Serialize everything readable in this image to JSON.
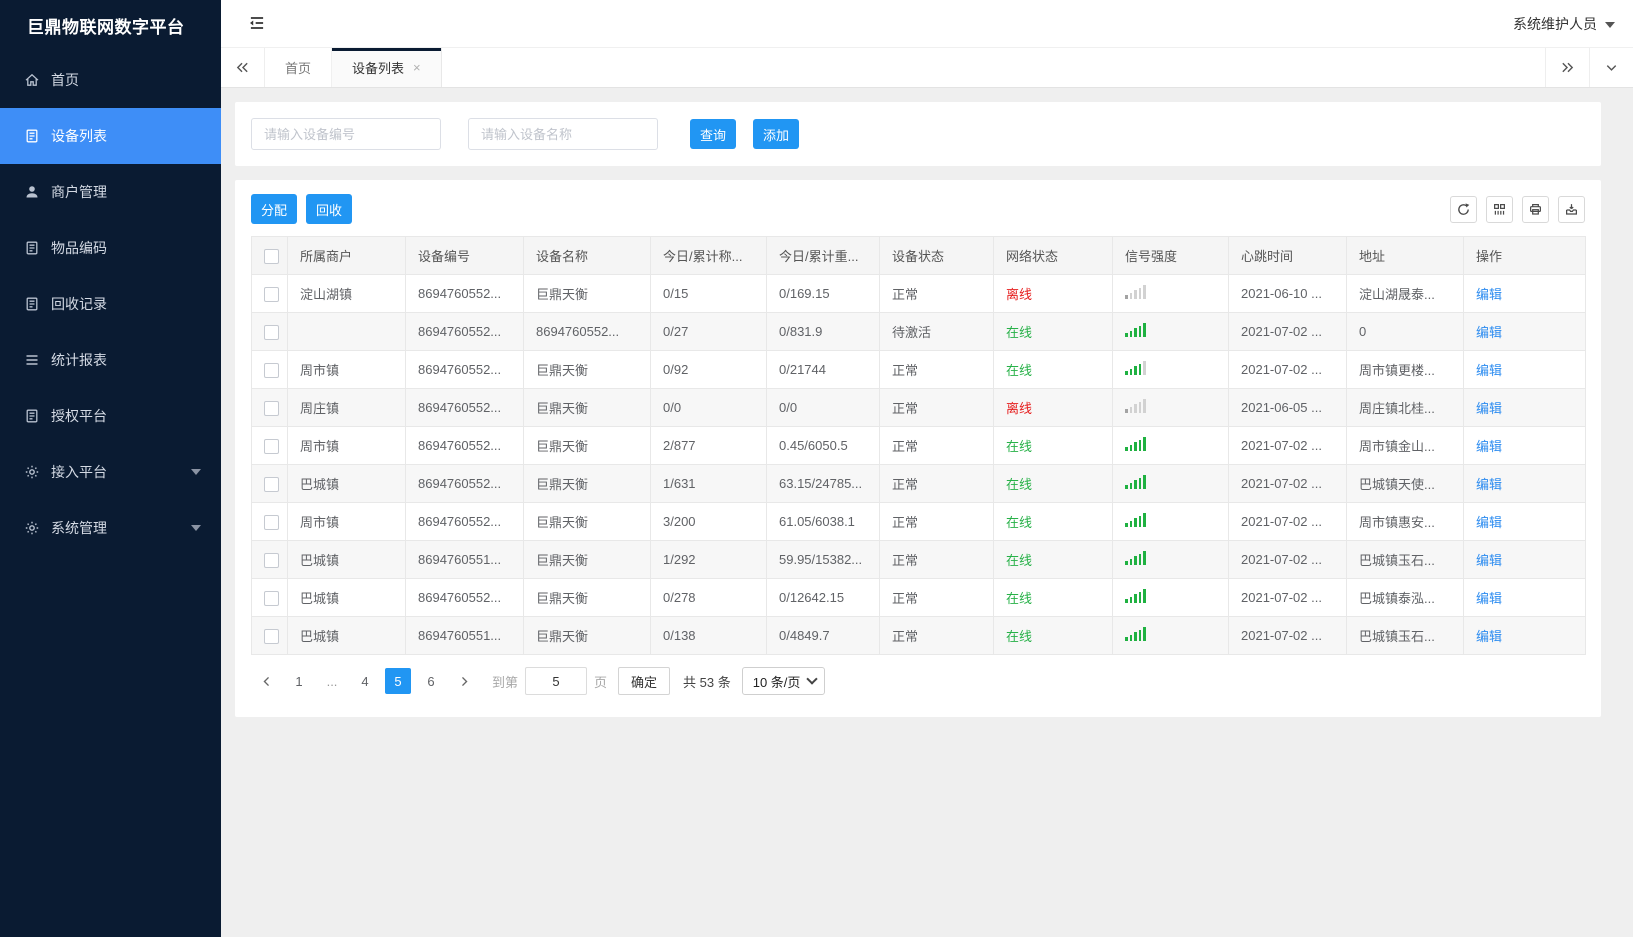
{
  "app": {
    "title": "巨鼎物联网数字平台",
    "user_menu": "系统维护人员"
  },
  "sidebar": {
    "items": [
      {
        "label": "首页",
        "icon": "home",
        "active": false,
        "expandable": false
      },
      {
        "label": "设备列表",
        "icon": "doc",
        "active": true,
        "expandable": false
      },
      {
        "label": "商户管理",
        "icon": "user",
        "active": false,
        "expandable": false
      },
      {
        "label": "物品编码",
        "icon": "doc",
        "active": false,
        "expandable": false
      },
      {
        "label": "回收记录",
        "icon": "doc",
        "active": false,
        "expandable": false
      },
      {
        "label": "统计报表",
        "icon": "menu",
        "active": false,
        "expandable": false
      },
      {
        "label": "授权平台",
        "icon": "doc",
        "active": false,
        "expandable": false
      },
      {
        "label": "接入平台",
        "icon": "gear",
        "active": false,
        "expandable": true
      },
      {
        "label": "系统管理",
        "icon": "gear",
        "active": false,
        "expandable": true
      }
    ]
  },
  "tabs": {
    "items": [
      {
        "label": "首页",
        "active": false,
        "closable": false
      },
      {
        "label": "设备列表",
        "active": true,
        "closable": true
      }
    ]
  },
  "search": {
    "device_no_placeholder": "请输入设备编号",
    "device_name_placeholder": "请输入设备名称",
    "query_label": "查询",
    "add_label": "添加"
  },
  "toolbar": {
    "assign_label": "分配",
    "recycle_label": "回收",
    "icons": [
      "refresh",
      "columns",
      "print",
      "export"
    ]
  },
  "table": {
    "headers": [
      "所属商户",
      "设备编号",
      "设备名称",
      "今日/累计称...",
      "今日/累计重...",
      "设备状态",
      "网络状态",
      "信号强度",
      "心跳时间",
      "地址",
      "操作"
    ],
    "edit_label": "编辑",
    "rows": [
      {
        "merchant": "淀山湖镇",
        "device_no": "8694760552...",
        "device_name": "巨鼎天衡",
        "today_count": "0/15",
        "today_weight": "0/169.15",
        "device_status": "正常",
        "network_status": "离线",
        "online": false,
        "signal_level": 0,
        "heartbeat": "2021-06-10 ...",
        "address": "淀山湖晟泰..."
      },
      {
        "merchant": "",
        "device_no": "8694760552...",
        "device_name": "8694760552...",
        "today_count": "0/27",
        "today_weight": "0/831.9",
        "device_status": "待激活",
        "network_status": "在线",
        "online": true,
        "signal_level": 5,
        "heartbeat": "2021-07-02 ...",
        "address": "0"
      },
      {
        "merchant": "周市镇",
        "device_no": "8694760552...",
        "device_name": "巨鼎天衡",
        "today_count": "0/92",
        "today_weight": "0/21744",
        "device_status": "正常",
        "network_status": "在线",
        "online": true,
        "signal_level": 4,
        "heartbeat": "2021-07-02 ...",
        "address": "周市镇更楼..."
      },
      {
        "merchant": "周庄镇",
        "device_no": "8694760552...",
        "device_name": "巨鼎天衡",
        "today_count": "0/0",
        "today_weight": "0/0",
        "device_status": "正常",
        "network_status": "离线",
        "online": false,
        "signal_level": 0,
        "heartbeat": "2021-06-05 ...",
        "address": "周庄镇北桂..."
      },
      {
        "merchant": "周市镇",
        "device_no": "8694760552...",
        "device_name": "巨鼎天衡",
        "today_count": "2/877",
        "today_weight": "0.45/6050.5",
        "device_status": "正常",
        "network_status": "在线",
        "online": true,
        "signal_level": 5,
        "heartbeat": "2021-07-02 ...",
        "address": "周市镇金山..."
      },
      {
        "merchant": "巴城镇",
        "device_no": "8694760552...",
        "device_name": "巨鼎天衡",
        "today_count": "1/631",
        "today_weight": "63.15/24785...",
        "device_status": "正常",
        "network_status": "在线",
        "online": true,
        "signal_level": 5,
        "heartbeat": "2021-07-02 ...",
        "address": "巴城镇天使..."
      },
      {
        "merchant": "周市镇",
        "device_no": "8694760552...",
        "device_name": "巨鼎天衡",
        "today_count": "3/200",
        "today_weight": "61.05/6038.1",
        "device_status": "正常",
        "network_status": "在线",
        "online": true,
        "signal_level": 5,
        "heartbeat": "2021-07-02 ...",
        "address": "周市镇惠安..."
      },
      {
        "merchant": "巴城镇",
        "device_no": "8694760551...",
        "device_name": "巨鼎天衡",
        "today_count": "1/292",
        "today_weight": "59.95/15382...",
        "device_status": "正常",
        "network_status": "在线",
        "online": true,
        "signal_level": 5,
        "heartbeat": "2021-07-02 ...",
        "address": "巴城镇玉石..."
      },
      {
        "merchant": "巴城镇",
        "device_no": "8694760552...",
        "device_name": "巨鼎天衡",
        "today_count": "0/278",
        "today_weight": "0/12642.15",
        "device_status": "正常",
        "network_status": "在线",
        "online": true,
        "signal_level": 5,
        "heartbeat": "2021-07-02 ...",
        "address": "巴城镇泰泓..."
      },
      {
        "merchant": "巴城镇",
        "device_no": "8694760551...",
        "device_name": "巨鼎天衡",
        "today_count": "0/138",
        "today_weight": "0/4849.7",
        "device_status": "正常",
        "network_status": "在线",
        "online": true,
        "signal_level": 5,
        "heartbeat": "2021-07-02 ...",
        "address": "巴城镇玉石..."
      }
    ]
  },
  "pagination": {
    "pages": [
      "1",
      "...",
      "4",
      "5",
      "6"
    ],
    "active_page": "5",
    "goto_label": "到第",
    "goto_value": "5",
    "page_unit_label": "页",
    "confirm_label": "确定",
    "total_label": "共 53 条",
    "page_size_label": "10 条/页"
  },
  "colors": {
    "sidebar_bg": "#0a1b32",
    "active_menu_blue": "#3e8ef7",
    "primary_blue": "#2196f3",
    "online_green": "#27b148",
    "offline_red": "#e61d1d",
    "link_blue": "#2d8cf0"
  }
}
